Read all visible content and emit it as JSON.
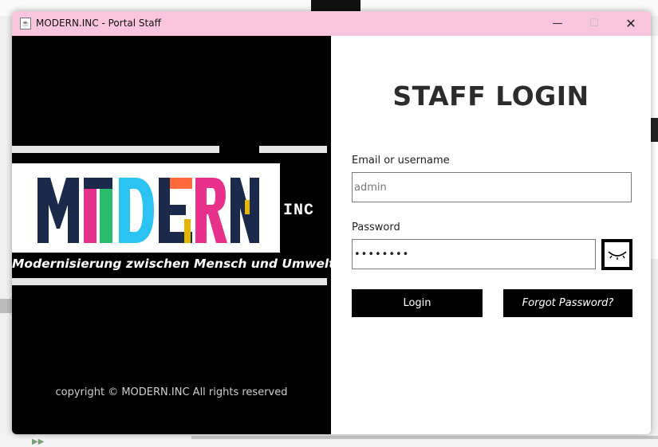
{
  "window": {
    "title": "MODERN.INC - Portal Staff",
    "icon": "java-cup-icon",
    "controls": {
      "minimize": "—",
      "maximize": "☐",
      "close": "✕"
    },
    "titlebar_color": "#f9c6dd"
  },
  "branding": {
    "logo_text": "MODERN",
    "logo_letter_colors": [
      "#1b2a4a",
      "#1b2a4a",
      "#e4b400",
      "#e8318a",
      "#2bbd6e",
      "#1b2a4a",
      "#ff6a3d"
    ],
    "suffix": "INC",
    "tagline": "Modernisierung zwischen Mensch und Umwelt.",
    "copyright": "copyright © MODERN.INC All rights reserved"
  },
  "login": {
    "title": "STAFF LOGIN",
    "email_label": "Email or username",
    "email_value": "admin",
    "password_label": "Password",
    "password_value": "••••••••",
    "show_password_icon": "eye-closed-icon",
    "login_button": "Login",
    "forgot_button": "Forgot Password?"
  }
}
